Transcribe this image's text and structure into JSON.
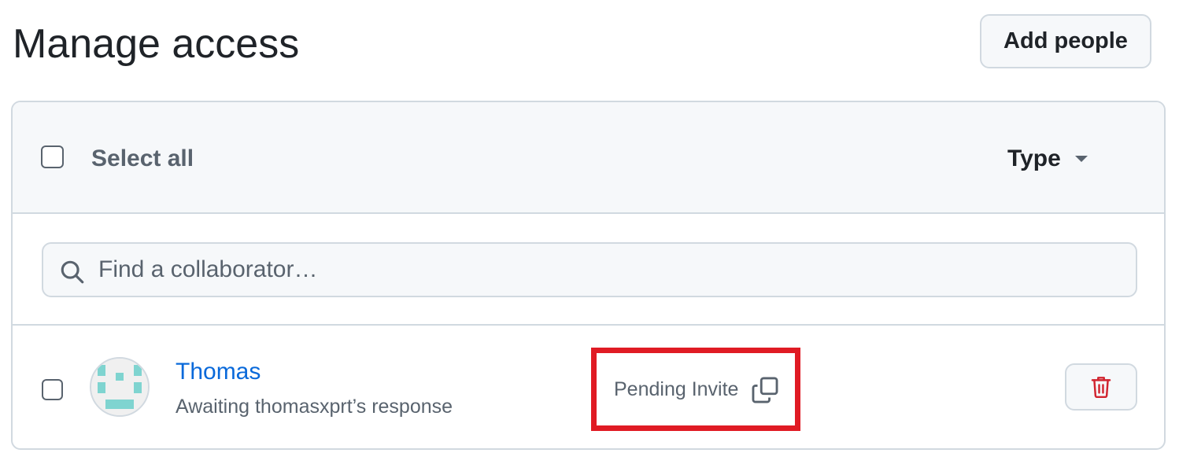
{
  "header": {
    "title": "Manage access",
    "add_people_label": "Add people"
  },
  "list_header": {
    "select_all_label": "Select all",
    "type_filter_label": "Type"
  },
  "search": {
    "placeholder": "Find a collaborator…",
    "value": ""
  },
  "collaborators": [
    {
      "name": "Thomas",
      "status": "Awaiting thomasxprt’s response",
      "invite_state": "Pending Invite",
      "avatar_color": "#7fd4d0"
    }
  ],
  "colors": {
    "link": "#0969da",
    "danger": "#d1242f",
    "highlight": "#e01b24"
  },
  "icons": {
    "search": "search-icon",
    "type_caret": "caret-down-icon",
    "copy": "copy-icon",
    "remove": "trash-icon"
  }
}
